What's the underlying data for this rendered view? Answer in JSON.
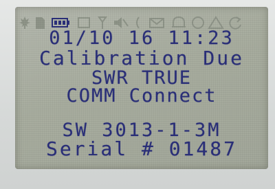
{
  "status_icons": [
    {
      "name": "maple-leaf-icon",
      "active": false
    },
    {
      "name": "document-icon",
      "active": false
    },
    {
      "name": "battery-icon",
      "active": true
    },
    {
      "name": "square-icon",
      "active": false
    },
    {
      "name": "antenna-icon",
      "active": false
    },
    {
      "name": "speaker-muted-icon",
      "active": false
    },
    {
      "name": "bracket-icon",
      "active": false
    },
    {
      "name": "envelope-icon",
      "active": false
    },
    {
      "name": "bell-icon",
      "active": false
    },
    {
      "name": "circle-icon",
      "active": false
    },
    {
      "name": "warning-triangle-icon",
      "active": false
    },
    {
      "name": "refresh-icon",
      "active": false
    }
  ],
  "colors": {
    "segment_on": "#2a2f7a",
    "segment_off": "#8e9488",
    "lcd_background": "#a8ad9f"
  },
  "display": {
    "datetime": "01/10 16 11:23",
    "message": "Calibration Due",
    "swr_status": "SWR TRUE",
    "comm_status": "COMM Connect",
    "software_version": "SW 3013-1-3M",
    "serial_number": "Serial # 01487"
  }
}
